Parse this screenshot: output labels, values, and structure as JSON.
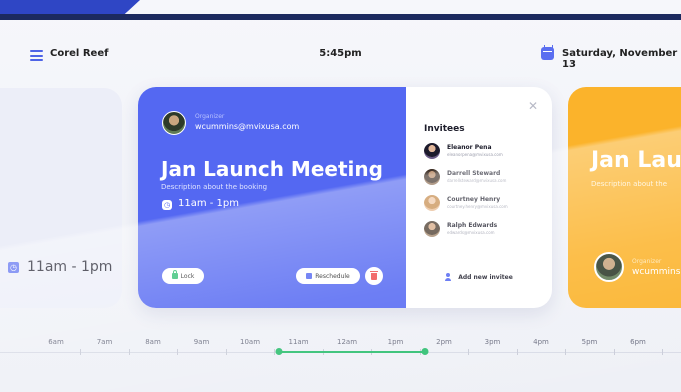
{
  "header": {
    "menu_icon": "hamburger-icon",
    "brand": "Corel Reef",
    "time": "5:45pm",
    "calendar_icon": "calendar-icon",
    "date": "Saturday, November 13"
  },
  "left_card": {
    "time": "11am - 1pm"
  },
  "main_card": {
    "organizer_label": "Organizer",
    "organizer_email": "wcummins@mvixusa.com",
    "title": "Jan Launch Meeting",
    "description": "Description about the booking",
    "time": "11am - 1pm",
    "lock_label": "Lock",
    "reschedule_label": "Reschedule",
    "accent_color": "#5468f2"
  },
  "invitees": {
    "title": "Invitees",
    "add_label": "Add new invitee",
    "people": [
      {
        "name": "Eleanor Pena",
        "email": "eleanorpena@mvixusa.com"
      },
      {
        "name": "Darrell Steward",
        "email": "darrellsteward@mvixusa.com"
      },
      {
        "name": "Courtney Henry",
        "email": "courtney.henry@mvixusa.com"
      },
      {
        "name": "Ralph Edwards",
        "email": "edwards@mvixusa.com"
      }
    ]
  },
  "right_card": {
    "title": "Jan Lau",
    "description": "Description about the",
    "organizer_label": "Organizer",
    "organizer_email": "wcummins",
    "color": "#fbb32b"
  },
  "timeline": {
    "hours": [
      "6am",
      "7am",
      "8am",
      "9am",
      "10am",
      "11am",
      "12am",
      "1pm",
      "2pm",
      "3pm",
      "4pm",
      "5pm",
      "6pm"
    ],
    "range_start": "11am",
    "range_end": "2pm",
    "range_color": "#2fbf71"
  }
}
